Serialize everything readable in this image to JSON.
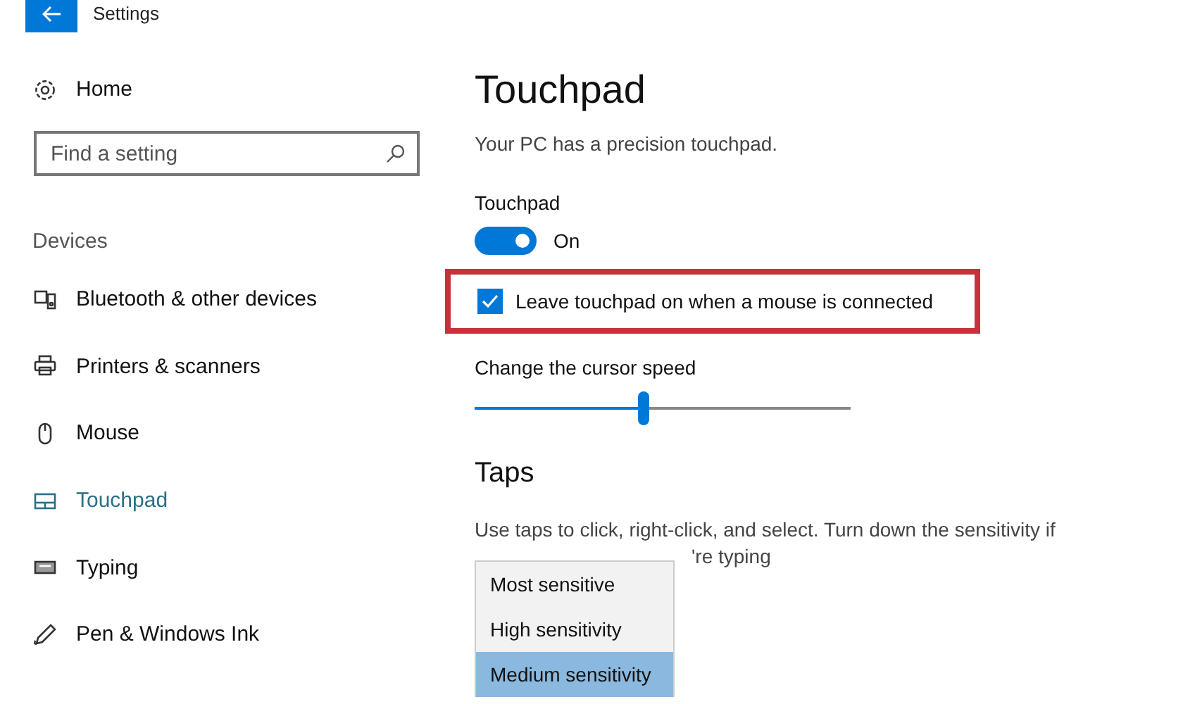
{
  "window": {
    "title": "Settings"
  },
  "sidebar": {
    "home": "Home",
    "search": {
      "placeholder": "Find a setting"
    },
    "section": "Devices",
    "items": [
      {
        "label": "Bluetooth & other devices",
        "selected": false
      },
      {
        "label": "Printers & scanners",
        "selected": false
      },
      {
        "label": "Mouse",
        "selected": false
      },
      {
        "label": "Touchpad",
        "selected": true
      },
      {
        "label": "Typing",
        "selected": false
      },
      {
        "label": "Pen & Windows Ink",
        "selected": false
      }
    ]
  },
  "main": {
    "title": "Touchpad",
    "subtitle": "Your PC has a precision touchpad.",
    "toggle": {
      "label": "Touchpad",
      "on": true,
      "state_text": "On"
    },
    "checkbox": {
      "label": "Leave touchpad on when a mouse is connected",
      "checked": true,
      "highlighted": true
    },
    "slider": {
      "label": "Change the cursor speed",
      "level": 0.45
    },
    "taps": {
      "heading": "Taps",
      "description_line_1": "Use taps to click, right-click, and select. Turn down the sensitivity if",
      "description_line_2": "'re typing"
    },
    "dropdown": {
      "options": [
        {
          "label": "Most sensitive",
          "selected": false
        },
        {
          "label": "High sensitivity",
          "selected": false
        },
        {
          "label": "Medium sensitivity",
          "selected": true
        }
      ]
    }
  }
}
